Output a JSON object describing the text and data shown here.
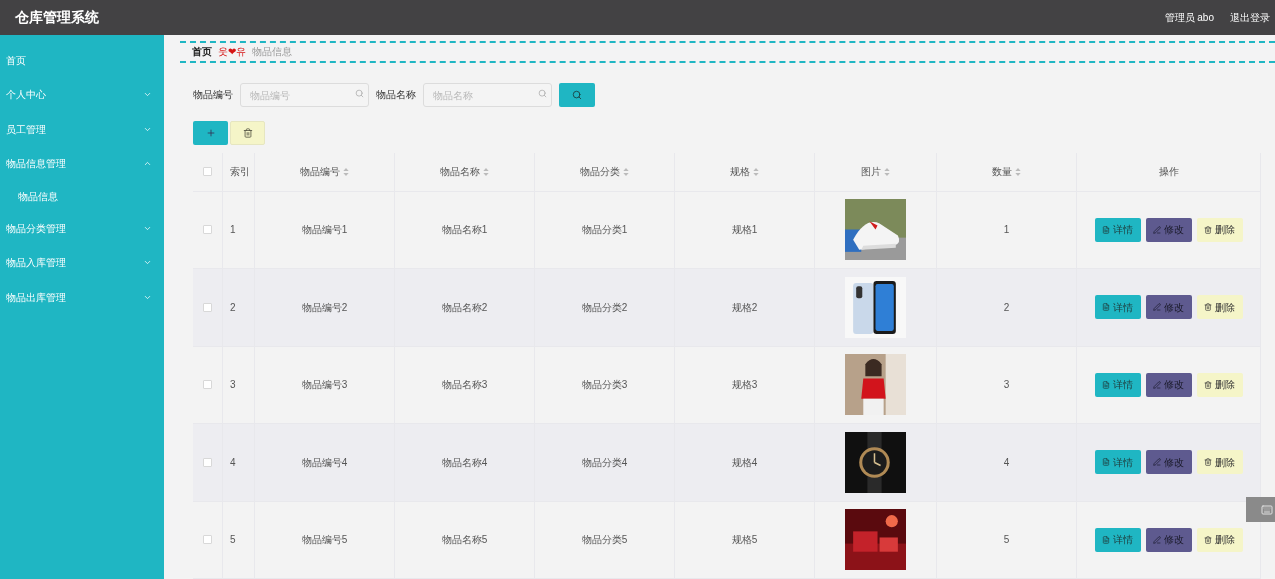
{
  "header": {
    "title": "仓库管理系统",
    "user": "管理员 abo",
    "logout": "退出登录"
  },
  "sidebar": {
    "items": [
      {
        "kind": "link",
        "label": "首页"
      },
      {
        "kind": "group",
        "label": "个人中心",
        "expanded": false
      },
      {
        "kind": "group",
        "label": "员工管理",
        "expanded": false
      },
      {
        "kind": "group",
        "label": "物品信息管理",
        "expanded": true,
        "children": [
          {
            "label": "物品信息"
          }
        ]
      },
      {
        "kind": "group",
        "label": "物品分类管理",
        "expanded": false
      },
      {
        "kind": "group",
        "label": "物品入库管理",
        "expanded": false
      },
      {
        "kind": "group",
        "label": "物品出库管理",
        "expanded": false
      }
    ]
  },
  "breadcrumb": {
    "home": "首页",
    "separator": "웃❤유",
    "current": "物品信息"
  },
  "search": {
    "fields": [
      {
        "label": "物品编号",
        "placeholder": "物品编号"
      },
      {
        "label": "物品名称",
        "placeholder": "物品名称"
      }
    ]
  },
  "table": {
    "all_checked": false,
    "columns": [
      {
        "label": "索引",
        "sortable": false
      },
      {
        "label": "物品编号",
        "sortable": true
      },
      {
        "label": "物品名称",
        "sortable": true
      },
      {
        "label": "物品分类",
        "sortable": true
      },
      {
        "label": "规格",
        "sortable": true
      },
      {
        "label": "图片",
        "sortable": true
      },
      {
        "label": "数量",
        "sortable": true
      },
      {
        "label": "操作",
        "sortable": false
      }
    ],
    "rows": [
      {
        "checked": false,
        "index": "1",
        "code": "物品编号1",
        "name": "物品名称1",
        "category": "物品分类1",
        "spec": "规格1",
        "quantity": "1",
        "actions": [
          {
            "kind": "detail",
            "label": "详情"
          },
          {
            "kind": "edit",
            "label": "修改"
          },
          {
            "kind": "delete",
            "label": "删除"
          }
        ]
      },
      {
        "checked": false,
        "index": "2",
        "code": "物品编号2",
        "name": "物品名称2",
        "category": "物品分类2",
        "spec": "规格2",
        "quantity": "2",
        "actions": [
          {
            "kind": "detail",
            "label": "详情"
          },
          {
            "kind": "edit",
            "label": "修改"
          },
          {
            "kind": "delete",
            "label": "删除"
          }
        ]
      },
      {
        "checked": false,
        "index": "3",
        "code": "物品编号3",
        "name": "物品名称3",
        "category": "物品分类3",
        "spec": "规格3",
        "quantity": "3",
        "actions": [
          {
            "kind": "detail",
            "label": "详情"
          },
          {
            "kind": "edit",
            "label": "修改"
          },
          {
            "kind": "delete",
            "label": "删除"
          }
        ]
      },
      {
        "checked": false,
        "index": "4",
        "code": "物品编号4",
        "name": "物品名称4",
        "category": "物品分类4",
        "spec": "规格4",
        "quantity": "4",
        "actions": [
          {
            "kind": "detail",
            "label": "详情"
          },
          {
            "kind": "edit",
            "label": "修改"
          },
          {
            "kind": "delete",
            "label": "删除"
          }
        ]
      },
      {
        "checked": false,
        "index": "5",
        "code": "物品编号5",
        "name": "物品名称5",
        "category": "物品分类5",
        "spec": "规格5",
        "quantity": "5",
        "actions": [
          {
            "kind": "detail",
            "label": "详情"
          },
          {
            "kind": "edit",
            "label": "修改"
          },
          {
            "kind": "delete",
            "label": "删除"
          }
        ]
      }
    ]
  }
}
